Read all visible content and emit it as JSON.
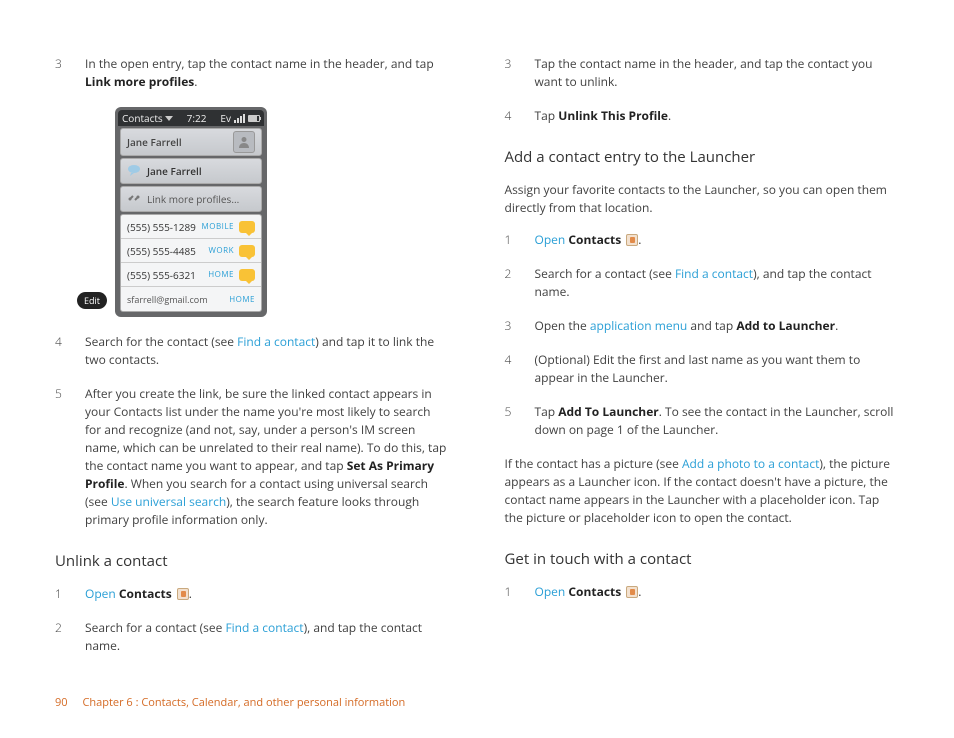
{
  "left": {
    "s3_num": "3",
    "s3_a": "In the open entry, tap the contact name in the header, and tap ",
    "s3_b": "Link more profiles",
    "s3_c": ".",
    "s4_num": "4",
    "s4_a": "Search for the contact (see ",
    "s4_link": "Find a contact",
    "s4_b": ") and tap it to link the two contacts.",
    "s5_num": "5",
    "s5_a": "After you create the link, be sure the linked contact appears in your Contacts list under the name you're most likely to search for and recognize (and not, say, under a person's IM screen name, which can be unrelated to their real name). To do this, tap the contact name you want to appear, and tap ",
    "s5_b": "Set As Primary Profile",
    "s5_c": ". When you search for a contact using universal search (see ",
    "s5_link": "Use universal search",
    "s5_d": "), the search feature looks through primary profile information only.",
    "sec1": "Unlink a contact",
    "u1_num": "1",
    "u1_link": "Open",
    "u1_b": "Contacts",
    "u1_c": ".",
    "u2_num": "2",
    "u2_a": "Search for a contact (see ",
    "u2_link": "Find a contact",
    "u2_b": "), and tap the contact name."
  },
  "right": {
    "s3_num": "3",
    "s3_a": "Tap the contact name in the header, and tap the contact you want to unlink.",
    "s4_num": "4",
    "s4_a": "Tap ",
    "s4_b": "Unlink This Profile",
    "s4_c": ".",
    "sec1": "Add a contact entry to the Launcher",
    "p1": "Assign your favorite contacts to the Launcher, so you can open them directly from that location.",
    "a1_num": "1",
    "a1_link": "Open",
    "a1_b": "Contacts",
    "a1_c": ".",
    "a2_num": "2",
    "a2_a": "Search for a contact (see ",
    "a2_link": "Find a contact",
    "a2_b": "), and tap the contact name.",
    "a3_num": "3",
    "a3_a": "Open the ",
    "a3_link": "application menu",
    "a3_b": " and tap ",
    "a3_c": "Add to Launcher",
    "a3_d": ".",
    "a4_num": "4",
    "a4_a": "(Optional) Edit the first and last name as you want them to appear in the Launcher.",
    "a5_num": "5",
    "a5_a": "Tap ",
    "a5_b": "Add To Launcher",
    "a5_c": ". To see the contact in the Launcher, scroll down on page 1 of the Launcher.",
    "p2_a": "If the contact has a picture (see ",
    "p2_link": "Add a photo to a contact",
    "p2_b": "), the picture appears as a Launcher icon. If the contact doesn't have a picture, the contact name appears in the Launcher with a placeholder icon. Tap the picture or placeholder icon to open the contact.",
    "sec2": "Get in touch with a contact",
    "g1_num": "1",
    "g1_link": "Open",
    "g1_b": "Contacts",
    "g1_c": "."
  },
  "phone": {
    "app": "Contacts",
    "time": "7:22",
    "ev": "Ev",
    "name_header": "Jane Farrell",
    "linked_name": "Jane Farrell",
    "link_more": "Link more profiles...",
    "rows": [
      {
        "num": "(555) 555-1289",
        "tag": "MOBILE"
      },
      {
        "num": "(555) 555-4485",
        "tag": "WORK"
      },
      {
        "num": "(555) 555-6321",
        "tag": "HOME"
      }
    ],
    "email": "sfarrell@gmail.com",
    "email_tag": "HOME",
    "edit": "Edit"
  },
  "footer": {
    "page": "90",
    "chapter": "Chapter 6  :  Contacts, Calendar, and other personal information"
  }
}
